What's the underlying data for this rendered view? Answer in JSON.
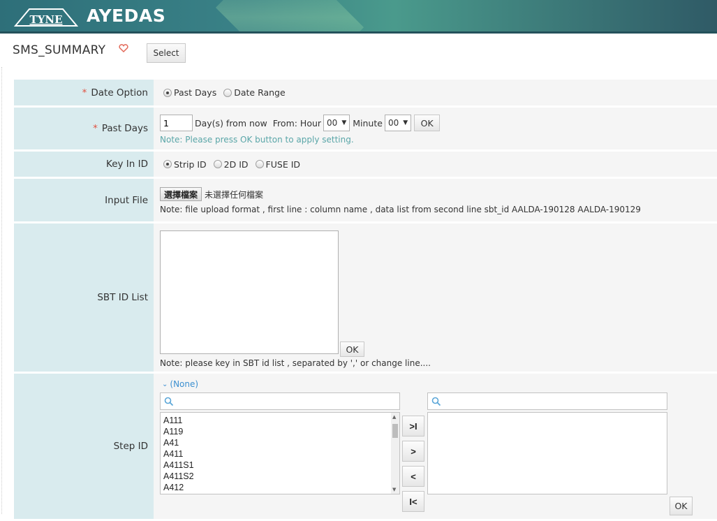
{
  "header": {
    "logo_text": "TYNE",
    "brand": "AYEDAS"
  },
  "page": {
    "title": "SMS_SUMMARY",
    "select_label": "Select"
  },
  "form": {
    "date_option": {
      "label": "Date Option",
      "required_mark": "*",
      "options": [
        "Past Days",
        "Date Range"
      ],
      "selected": "Past Days"
    },
    "past_days": {
      "label": "Past Days",
      "required_mark": "*",
      "days_value": "1",
      "days_suffix": "Day(s) from now",
      "from_hour_label": "From: Hour",
      "hour_value": "00",
      "minute_label": "Minute",
      "minute_value": "00",
      "ok_label": "OK",
      "note": "Note: Please press OK button to apply setting."
    },
    "key_in_id": {
      "label": "Key In ID",
      "options": [
        "Strip ID",
        "2D ID",
        "FUSE ID"
      ],
      "selected": "Strip ID"
    },
    "input_file": {
      "label": "Input File",
      "choose_button": "選擇檔案",
      "no_file_text": "未選擇任何檔案",
      "note": "Note: file upload format , first line : column name , data list from second line sbt_id AALDA-190128 AALDA-190129"
    },
    "sbt_id_list": {
      "label": "SBT ID List",
      "value": "",
      "ok_label": "OK",
      "note": "Note: please key in SBT id list , separated by ',' or change line...."
    },
    "step_id": {
      "label": "Step ID",
      "filter_toggle": "(None)",
      "left_search_placeholder": "",
      "right_search_placeholder": "",
      "available_items": [
        "A111",
        "A119",
        "A41",
        "A411",
        "A411S1",
        "A411S2",
        "A412"
      ],
      "selected_items": [],
      "buttons": {
        "move_all_right": ">I",
        "move_right": ">",
        "move_left": "<",
        "move_all_left": "I<"
      },
      "ok_label": "OK"
    }
  },
  "colors": {
    "header_bg": "#2e6f79",
    "label_bg": "#d9ebee",
    "field_bg": "#f5f5f5",
    "required": "#e05040",
    "note_teal": "#5aa6a8",
    "link_blue": "#3b8fd0"
  }
}
